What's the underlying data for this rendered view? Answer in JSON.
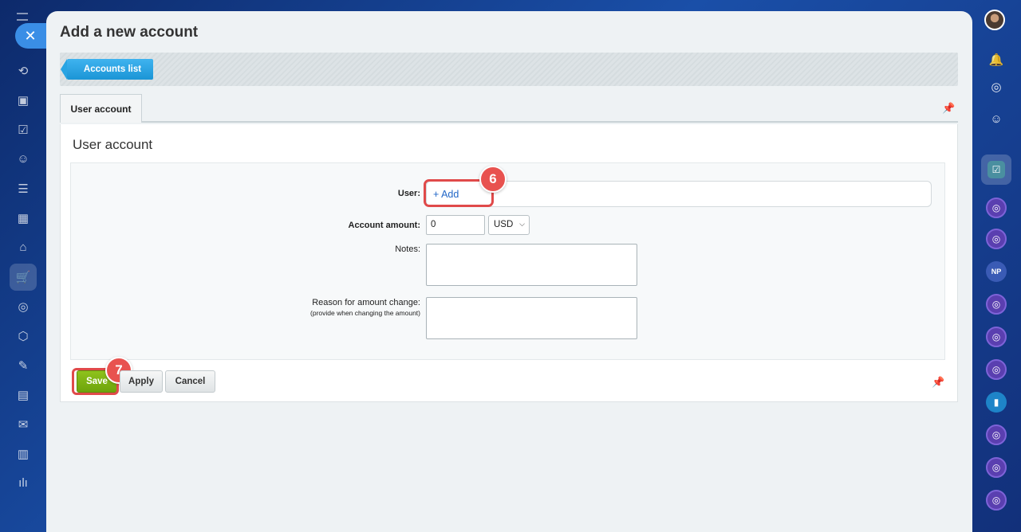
{
  "panel": {
    "title": "Add a new account",
    "accounts_list_button": "Accounts list",
    "tab_label": "User account",
    "section_title": "User account"
  },
  "form": {
    "user_label": "User:",
    "user_add_link": "+ Add",
    "amount_label": "Account amount:",
    "amount_value": "0",
    "currency_value": "USD",
    "notes_label": "Notes:",
    "reason_label": "Reason for amount change:",
    "reason_hint": "(provide when changing the amount)"
  },
  "buttons": {
    "save": "Save",
    "apply": "Apply",
    "cancel": "Cancel"
  },
  "annotations": {
    "step_add": "6",
    "step_save": "7"
  },
  "colors": {
    "accent_blue": "#1b95d6",
    "save_green": "#7ab414",
    "highlight_red": "#e04a4a"
  }
}
